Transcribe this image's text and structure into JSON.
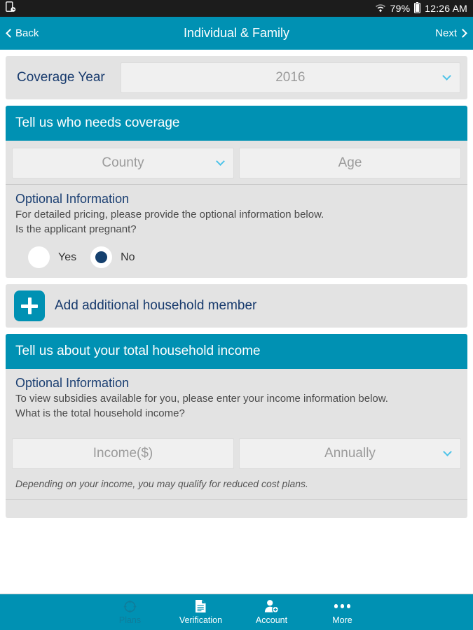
{
  "status_bar": {
    "left_icon": "device-sync-icon",
    "wifi_icon": "wifi-icon",
    "battery_percent": "79%",
    "battery_icon": "battery-icon",
    "clock": "12:26 AM"
  },
  "header": {
    "back_label": "Back",
    "title": "Individual & Family",
    "next_label": "Next"
  },
  "coverage": {
    "label": "Coverage Year",
    "value": "2016"
  },
  "who_needs_coverage": {
    "section_title": "Tell us who needs coverage",
    "county_placeholder": "County",
    "age_placeholder": "Age",
    "optional_title": "Optional Information",
    "optional_line1": "For detailed pricing, please provide the optional information below.",
    "optional_line2": "Is the applicant pregnant?",
    "radio_yes": "Yes",
    "radio_no": "No",
    "selected": "No"
  },
  "add_member": {
    "label": "Add additional household member",
    "icon": "plus-icon"
  },
  "household_income": {
    "section_title": "Tell us about your total household income",
    "optional_title": "Optional Information",
    "optional_line1": "To view subsidies available for you, please enter your income information below.",
    "optional_line2": "What is the total household income?",
    "income_placeholder": "Income($)",
    "frequency_value": "Annually",
    "note": "Depending on your income, you may qualify for reduced cost plans."
  },
  "tabbar": {
    "items": [
      {
        "label": "Plans",
        "icon": "target-icon",
        "active": true
      },
      {
        "label": "Verification",
        "icon": "document-icon",
        "active": false
      },
      {
        "label": "Account",
        "icon": "person-add-icon",
        "active": false
      },
      {
        "label": "More",
        "icon": "ellipsis-icon",
        "active": false
      }
    ]
  },
  "colors": {
    "brand_teal": "#0091b3",
    "navy": "#173a6d",
    "card_gray": "#e3e3e3",
    "field_gray": "#f0f0f0",
    "status_bar": "#1c1c1c"
  }
}
